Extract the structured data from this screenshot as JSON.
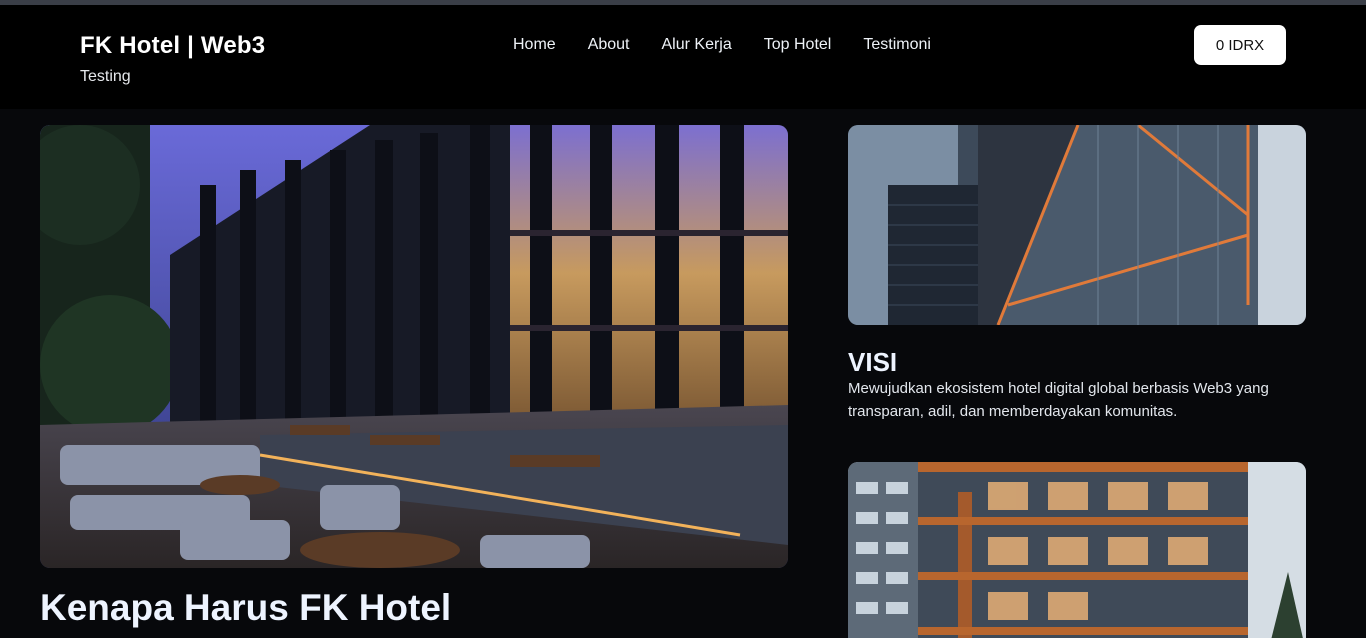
{
  "header": {
    "brand_title": "FK Hotel | Web3",
    "brand_subtitle": "Testing",
    "nav": [
      "Home",
      "About",
      "Alur Kerja",
      "Top Hotel",
      "Testimoni"
    ],
    "wallet_balance": "0 IDRX"
  },
  "main": {
    "hero_image": "hotel-terrace-night-photo",
    "why_title": "Kenapa Harus FK Hotel",
    "cards": [
      {
        "image": "glass-tower-photo"
      },
      {
        "title": "VISI",
        "text": "Mewujudkan ekosistem hotel digital global berbasis Web3 yang transparan, adil, dan memberdayakan komunitas."
      },
      {
        "image": "residential-balcony-tower-photo"
      }
    ]
  },
  "colors": {
    "background": "#07080b",
    "header": "#000000",
    "button": "#ffffff",
    "heading": "#eef4ff"
  }
}
